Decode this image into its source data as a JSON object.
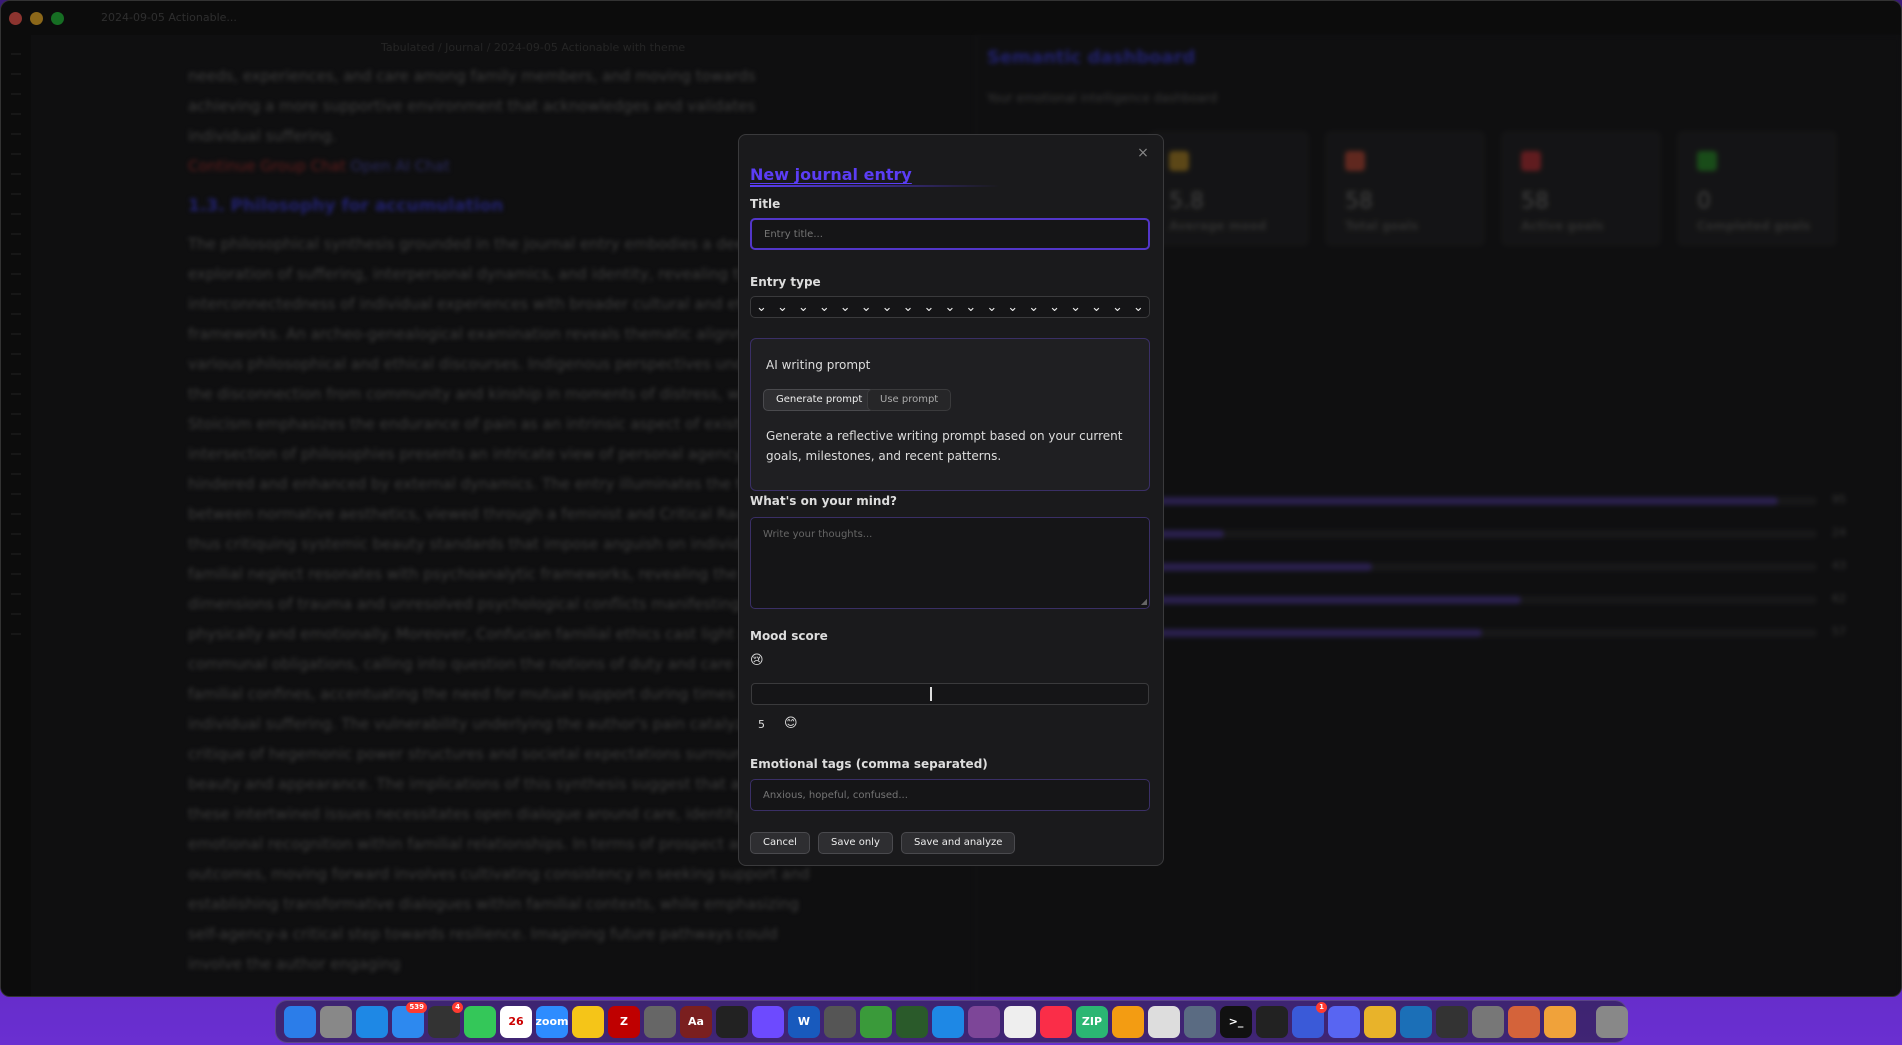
{
  "window": {
    "tab_title": "2024-09-05 Actionable...",
    "breadcrumb": "Tabulated / Journal / 2024-09-05 Actionable with theme"
  },
  "editor": {
    "paragraphs": [
      "needs, experiences, and care among family members, and moving towards achieving a more supportive environment that acknowledges and validates individual suffering.",
      "The philosophical synthesis grounded in the journal entry embodies a deep exploration of suffering, interpersonal dynamics, and identity, revealing the interconnectedness of individual experiences with broader cultural and ethical frameworks. An archeo-genealogical examination reveals thematic alignment with various philosophical and ethical discourses. Indigenous perspectives underscore the disconnection from community and kinship in moments of distress, while Stoicism emphasizes the endurance of pain as an intrinsic aspect of existence. This intersection of philosophies presents an intricate view of personal agency both hindered and enhanced by external dynamics. The entry illuminates the tension between normative aesthetics, viewed through a feminist and Critical Race lens, thus critiquing systemic beauty standards that impose anguish on individuals. The familial neglect resonates with psychoanalytic frameworks, revealing the emotional dimensions of trauma and unresolved psychological conflicts manifesting both physically and emotionally. Moreover, Confucian familial ethics cast light on communal obligations, calling into question the notions of duty and care within familial confines, accentuating the need for mutual support during times of individual suffering. The vulnerability underlying the author's pain catalyzes a critique of hegemonic power structures and societal expectations surrounding beauty and appearance. The implications of this synthesis suggest that addressing these intertwined issues necessitates open dialogue around care, identity, and emotional recognition within familial relationships. In terms of prospect and outcomes, moving forward involves cultivating consistency in seeking support and establishing transformative dialogues within familial contexts, while emphasizing self-agency-a critical step towards resilience. Imagining future pathways could involve the author engaging"
    ],
    "red_label": "Continue Group Chat",
    "link_label": "Open AI Chat",
    "heading": "1.3. Philosophy for accumulation"
  },
  "dashboard": {
    "title": "Semantic dashboard",
    "subtitle": "Your emotional intelligence dashboard",
    "stats": [
      {
        "value": "5.8",
        "label": "Average mood",
        "color": "#a8822a"
      },
      {
        "value": "58",
        "label": "Total goals",
        "color": "#b04a3a"
      },
      {
        "value": "58",
        "label": "Active goals",
        "color": "#b0343a"
      },
      {
        "value": "0",
        "label": "Completed goals",
        "color": "#2f8a2f"
      }
    ],
    "bars": [
      {
        "pct": 0.95,
        "value": "95"
      },
      {
        "pct": 0.24,
        "value": "24"
      },
      {
        "pct": 0.43,
        "value": "43"
      },
      {
        "pct": 0.62,
        "value": "62"
      },
      {
        "pct": 0.57,
        "value": "57"
      }
    ]
  },
  "modal": {
    "title": "New journal entry",
    "close_icon": "×",
    "title_label": "Title",
    "title_placeholder": "Entry title...",
    "entry_type_label": "Entry type",
    "ai_prompt_title": "AI writing prompt",
    "generate_prompt": "Generate prompt",
    "use_prompt": "Use prompt",
    "ai_prompt_description": "Generate a reflective writing prompt based on your current goals, milestones, and recent patterns.",
    "mind_label": "What's on your mind?",
    "mind_placeholder": "Write your thoughts...",
    "mood_label": "Mood score",
    "mood_value": "5",
    "mood_level": 0.45,
    "tags_label": "Emotional tags (comma separated)",
    "tags_placeholder": "Anxious, hopeful, confused...",
    "cancel": "Cancel",
    "save_only": "Save only",
    "save_analyze": "Save and analyze"
  },
  "dock": {
    "items": [
      {
        "name": "finder",
        "color": "#2b7de9",
        "label": ""
      },
      {
        "name": "launchpad",
        "color": "#888",
        "label": ""
      },
      {
        "name": "safari",
        "color": "#1e88e5",
        "label": ""
      },
      {
        "name": "mail",
        "color": "#2d89ef",
        "label": "",
        "badge": "539"
      },
      {
        "name": "reminders",
        "color": "#333",
        "label": "",
        "badge": "4"
      },
      {
        "name": "messages",
        "color": "#34c759",
        "label": ""
      },
      {
        "name": "calendar",
        "color": "#fff",
        "label": "26"
      },
      {
        "name": "zoom",
        "color": "#2d8cff",
        "label": "zoom"
      },
      {
        "name": "notes",
        "color": "#f5c518",
        "label": ""
      },
      {
        "name": "filezilla",
        "color": "#bf0000",
        "label": "Z"
      },
      {
        "name": "disk",
        "color": "#666",
        "label": ""
      },
      {
        "name": "dictionary",
        "color": "#7a1f1f",
        "label": "Aa"
      },
      {
        "name": "chatgpt",
        "color": "#222",
        "label": ""
      },
      {
        "name": "proton",
        "color": "#6d4aff",
        "label": ""
      },
      {
        "name": "word",
        "color": "#185abd",
        "label": "W"
      },
      {
        "name": "calculator",
        "color": "#555",
        "label": ""
      },
      {
        "name": "aqua",
        "color": "#3a9a3a",
        "label": ""
      },
      {
        "name": "tree",
        "color": "#2a5a2a",
        "label": ""
      },
      {
        "name": "vscode",
        "color": "#1e88e5",
        "label": ""
      },
      {
        "name": "tor",
        "color": "#7d4698",
        "label": ""
      },
      {
        "name": "files",
        "color": "#eee",
        "label": ""
      },
      {
        "name": "music",
        "color": "#fa2d48",
        "label": ""
      },
      {
        "name": "archive",
        "color": "#2bb673",
        "label": "ZIP"
      },
      {
        "name": "photos",
        "color": "#f39c12",
        "label": ""
      },
      {
        "name": "claquette",
        "color": "#ddd",
        "label": ""
      },
      {
        "name": "xcode",
        "color": "#5a6b82",
        "label": ""
      },
      {
        "name": "terminal",
        "color": "#111",
        "label": ">_"
      },
      {
        "name": "activity",
        "color": "#222",
        "label": ""
      },
      {
        "name": "bot",
        "color": "#3a5ad8",
        "label": "",
        "badge": "1"
      },
      {
        "name": "discord",
        "color": "#5865f2",
        "label": ""
      },
      {
        "name": "chrome",
        "color": "#e8b32a",
        "label": ""
      },
      {
        "name": "screen",
        "color": "#1b6fb7",
        "label": ""
      },
      {
        "name": "dark",
        "color": "#333",
        "label": ""
      },
      {
        "name": "preview",
        "color": "#777",
        "label": ""
      },
      {
        "name": "claude",
        "color": "#d4633a",
        "label": ""
      },
      {
        "name": "books",
        "color": "#f0a23a",
        "label": ""
      },
      {
        "name": "trash",
        "color": "#888",
        "label": ""
      }
    ]
  }
}
